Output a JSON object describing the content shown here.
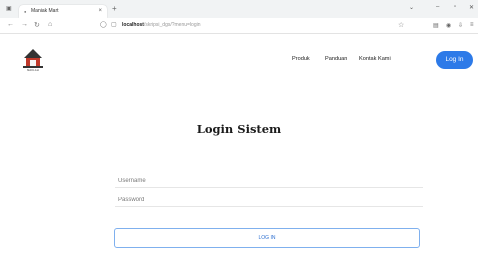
{
  "browser": {
    "tab_title": "Maniak Mart",
    "new_tab_glyph": "+",
    "close_glyph": "×",
    "url_host": "localhost",
    "url_path": "/skripsi_dgs/?menu=login",
    "icons": [
      "back-icon",
      "forward-icon",
      "reload-icon",
      "home-icon",
      "star-icon",
      "extensions-icon",
      "profile-icon",
      "menu-icon"
    ]
  },
  "site": {
    "brand_text": "MAKLAH",
    "nav": [
      "Produk",
      "Panduan",
      "Kontak Kami"
    ],
    "login_button": "Log In"
  },
  "form": {
    "heading": "Login Sistem",
    "username_placeholder": "Username",
    "password_placeholder": "Password",
    "submit_label": "LOG IN"
  },
  "colors": {
    "accent": "#2d7ae8",
    "submit_border": "#7fb0ee"
  }
}
